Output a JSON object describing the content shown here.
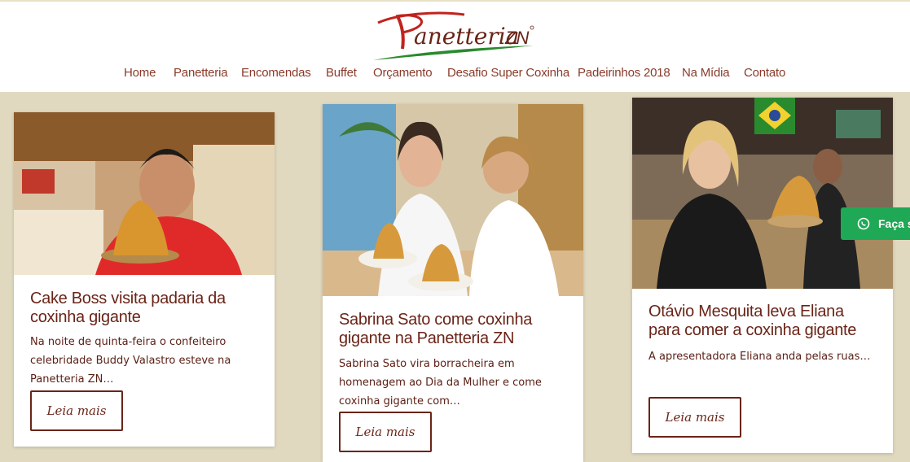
{
  "header": {
    "logo_text": "Panetteria ZN",
    "nav": [
      "Home",
      "Panetteria",
      "Encomendas",
      "Buffet",
      "Orçamento",
      "Desafio Super Coxinha",
      "Padeirinhos 2018",
      "Na Mídia",
      "Contato"
    ]
  },
  "cards": [
    {
      "title": "Cake Boss visita padaria da coxinha gigante",
      "excerpt": "Na noite de quinta-feira o confeiteiro celebridade Buddy Valastro esteve na Panetteria ZN…",
      "button": "Leia mais"
    },
    {
      "title": "Sabrina Sato come coxinha gigante na Panetteria ZN",
      "excerpt": "Sabrina Sato vira borracheira em homenagem ao Dia da Mulher e come coxinha gigante com…",
      "button": "Leia mais"
    },
    {
      "title": "Otávio Mesquita leva Eliana para comer a coxinha gigante",
      "excerpt": "A apresentadora Eliana anda pelas ruas…",
      "button": "Leia mais"
    }
  ],
  "whatsapp": {
    "label": "Faça s",
    "icon": "whatsapp-icon"
  },
  "colors": {
    "nav": "#8a3b2a",
    "title": "#6a2418",
    "background": "#e0d9bf",
    "whatsapp": "#1fa855",
    "logo_green": "#2a8a2e",
    "logo_red": "#c0231e"
  }
}
